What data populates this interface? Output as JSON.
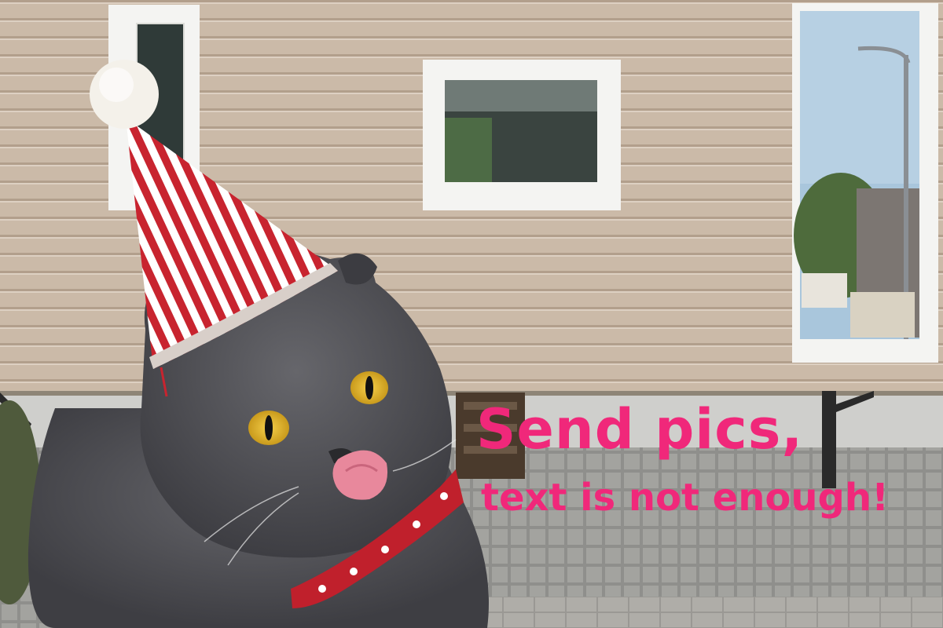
{
  "caption": {
    "line1": "Send pics,",
    "line2": "text is not enough!"
  },
  "colors": {
    "caption": "#f0287a",
    "siding": "#c9b8a6",
    "cat_fur": "#4d4d52",
    "cat_eyes": "#e6b52a",
    "hat_stripe_red": "#c8242f",
    "hat_stripe_white": "#ffffff",
    "collar": "#c0202c",
    "window_frame": "#f4f4f2",
    "paving": "#8f8f8c"
  },
  "icons": [
    "party-hat-icon",
    "star-collar-icon"
  ]
}
